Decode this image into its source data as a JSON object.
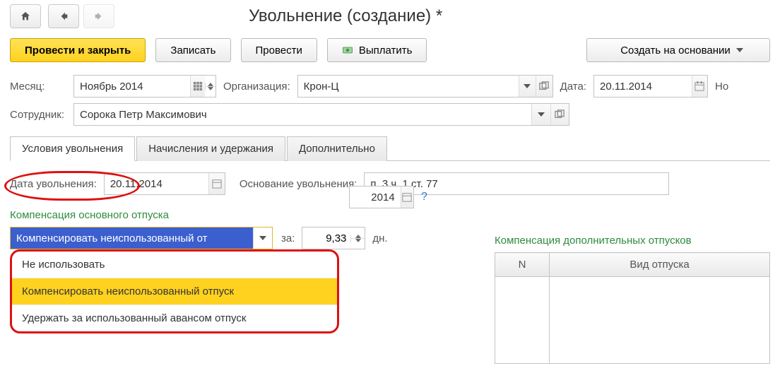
{
  "header": {
    "title": "Увольнение (создание) *"
  },
  "toolbar": {
    "post_close": "Провести и закрыть",
    "save": "Записать",
    "post": "Провести",
    "pay": "Выплатить",
    "create_based": "Создать на основании"
  },
  "row1": {
    "month_label": "Месяц:",
    "month_value": "Ноябрь 2014",
    "org_label": "Организация:",
    "org_value": "Крон-Ц",
    "date_label": "Дата:",
    "date_value": "20.11.2014",
    "number_label": "Но"
  },
  "row2": {
    "emp_label": "Сотрудник:",
    "emp_value": "Сорока Петр Максимович"
  },
  "tabs": {
    "t1": "Условия увольнения",
    "t2": "Начисления и удержания",
    "t3": "Дополнительно"
  },
  "cond": {
    "dismiss_date_label": "Дата увольнения:",
    "dismiss_date_value": "20.11.2014",
    "reason_label": "Основание увольнения:",
    "reason_value": "п. 3 ч. 1 ст. 77"
  },
  "comp": {
    "title": "Компенсация основного отпуска",
    "selected": "Компенсировать неиспользованный от",
    "for_label": "за:",
    "days_value": "9,33",
    "days_unit": "дн.",
    "options": {
      "o1": "Не использовать",
      "o2": "Компенсировать неиспользованный отпуск",
      "o3": "Удержать за использованный авансом отпуск"
    },
    "period_end": "2014",
    "qmark": "?"
  },
  "extra": {
    "title": "Компенсация дополнительных отпусков",
    "col_n": "N",
    "col_type": "Вид отпуска"
  }
}
